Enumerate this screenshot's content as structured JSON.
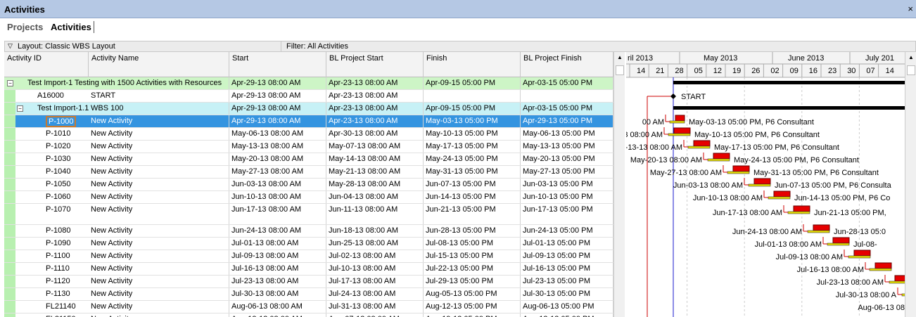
{
  "window": {
    "title": "Activities",
    "close": "×"
  },
  "tabs": [
    {
      "label": "Projects"
    },
    {
      "label": "Activities"
    }
  ],
  "layout_bar": {
    "layout": "Layout: Classic WBS Layout",
    "filter": "Filter: All Activities"
  },
  "columns": [
    "Activity ID",
    "Activity Name",
    "Start",
    "BL Project Start",
    "Finish",
    "BL Project Finish"
  ],
  "rows": [
    {
      "kind": "wbs1",
      "toggle": "−",
      "id": "Test Import-1",
      "name": "Testing with 1500 Activities with Resources",
      "start": "Apr-29-13 08:00 AM",
      "bl_start": "Apr-23-13 08:00 AM",
      "finish": "Apr-09-15 05:00 PM",
      "bl_finish": "Apr-03-15 05:00 PM"
    },
    {
      "kind": "act",
      "id": "A16000",
      "name": "START",
      "start": "Apr-29-13 08:00 AM",
      "bl_start": "Apr-23-13 08:00 AM",
      "finish": "",
      "bl_finish": ""
    },
    {
      "kind": "wbs2",
      "toggle": "−",
      "id": "Test Import-1.1",
      "name": "WBS 100",
      "start": "Apr-29-13 08:00 AM",
      "bl_start": "Apr-23-13 08:00 AM",
      "finish": "Apr-09-15 05:00 PM",
      "bl_finish": "Apr-03-15 05:00 PM"
    },
    {
      "kind": "sel",
      "id": "P-1000",
      "name": "New Activity",
      "start": "Apr-29-13 08:00 AM",
      "bl_start": "Apr-23-13 08:00 AM",
      "finish": "May-03-13 05:00 PM",
      "bl_finish": "Apr-29-13 05:00 PM"
    },
    {
      "kind": "act",
      "id": "P-1010",
      "name": "New Activity",
      "start": "May-06-13 08:00 AM",
      "bl_start": "Apr-30-13 08:00 AM",
      "finish": "May-10-13 05:00 PM",
      "bl_finish": "May-06-13 05:00 PM"
    },
    {
      "kind": "act",
      "id": "P-1020",
      "name": "New Activity",
      "start": "May-13-13 08:00 AM",
      "bl_start": "May-07-13 08:00 AM",
      "finish": "May-17-13 05:00 PM",
      "bl_finish": "May-13-13 05:00 PM"
    },
    {
      "kind": "act",
      "id": "P-1030",
      "name": "New Activity",
      "start": "May-20-13 08:00 AM",
      "bl_start": "May-14-13 08:00 AM",
      "finish": "May-24-13 05:00 PM",
      "bl_finish": "May-20-13 05:00 PM"
    },
    {
      "kind": "act",
      "id": "P-1040",
      "name": "New Activity",
      "start": "May-27-13 08:00 AM",
      "bl_start": "May-21-13 08:00 AM",
      "finish": "May-31-13 05:00 PM",
      "bl_finish": "May-27-13 05:00 PM"
    },
    {
      "kind": "act",
      "id": "P-1050",
      "name": "New Activity",
      "start": "Jun-03-13 08:00 AM",
      "bl_start": "May-28-13 08:00 AM",
      "finish": "Jun-07-13 05:00 PM",
      "bl_finish": "Jun-03-13 05:00 PM"
    },
    {
      "kind": "act",
      "id": "P-1060",
      "name": "New Activity",
      "start": "Jun-10-13 08:00 AM",
      "bl_start": "Jun-04-13 08:00 AM",
      "finish": "Jun-14-13 05:00 PM",
      "bl_finish": "Jun-10-13 05:00 PM"
    },
    {
      "kind": "tall",
      "id": "P-1070",
      "name": "New Activity",
      "start": "Jun-17-13 08:00 AM",
      "bl_start": "Jun-11-13 08:00 AM",
      "finish": "Jun-21-13 05:00 PM",
      "bl_finish": "Jun-17-13 05:00 PM"
    },
    {
      "kind": "act",
      "id": "P-1080",
      "name": "New Activity",
      "start": "Jun-24-13 08:00 AM",
      "bl_start": "Jun-18-13 08:00 AM",
      "finish": "Jun-28-13 05:00 PM",
      "bl_finish": "Jun-24-13 05:00 PM"
    },
    {
      "kind": "act",
      "id": "P-1090",
      "name": "New Activity",
      "start": "Jul-01-13 08:00 AM",
      "bl_start": "Jun-25-13 08:00 AM",
      "finish": "Jul-08-13 05:00 PM",
      "bl_finish": "Jul-01-13 05:00 PM"
    },
    {
      "kind": "act",
      "id": "P-1100",
      "name": "New Activity",
      "start": "Jul-09-13 08:00 AM",
      "bl_start": "Jul-02-13 08:00 AM",
      "finish": "Jul-15-13 05:00 PM",
      "bl_finish": "Jul-09-13 05:00 PM"
    },
    {
      "kind": "act",
      "id": "P-1110",
      "name": "New Activity",
      "start": "Jul-16-13 08:00 AM",
      "bl_start": "Jul-10-13 08:00 AM",
      "finish": "Jul-22-13 05:00 PM",
      "bl_finish": "Jul-16-13 05:00 PM"
    },
    {
      "kind": "act",
      "id": "P-1120",
      "name": "New Activity",
      "start": "Jul-23-13 08:00 AM",
      "bl_start": "Jul-17-13 08:00 AM",
      "finish": "Jul-29-13 05:00 PM",
      "bl_finish": "Jul-23-13 05:00 PM"
    },
    {
      "kind": "act",
      "id": "P-1130",
      "name": "New Activity",
      "start": "Jul-30-13 08:00 AM",
      "bl_start": "Jul-24-13 08:00 AM",
      "finish": "Aug-05-13 05:00 PM",
      "bl_finish": "Jul-30-13 05:00 PM"
    },
    {
      "kind": "act",
      "id": "FL21140",
      "name": "New Activity",
      "start": "Aug-06-13 08:00 AM",
      "bl_start": "Jul-31-13 08:00 AM",
      "finish": "Aug-12-13 05:00 PM",
      "bl_finish": "Aug-06-13 05:00 PM"
    },
    {
      "kind": "act",
      "id": "FL21150",
      "name": "New Activity",
      "start": "Aug-13-13 08:00 AM",
      "bl_start": "Aug-07-13 08:00 AM",
      "finish": "Aug-19-13 05:00 PM",
      "bl_finish": "Aug-13-13 05:00 PM"
    }
  ],
  "gantt": {
    "months": [
      "ril 2013",
      "May 2013",
      "June 2013",
      "July 201"
    ],
    "weeks": [
      "14",
      "21",
      "28",
      "05",
      "12",
      "19",
      "26",
      "02",
      "09",
      "16",
      "23",
      "30",
      "07",
      "14"
    ],
    "milestone_label": "START",
    "bars": [
      {
        "left": "00 AM",
        "right": "May-03-13 05:00 PM, P6 Consultant"
      },
      {
        "left": "3 08:00 AM",
        "right": "May-10-13 05:00 PM, P6 Consultant"
      },
      {
        "left": "y-13-13 08:00 AM",
        "right": "May-17-13 05:00 PM, P6 Consultant"
      },
      {
        "left": "May-20-13 08:00 AM",
        "right": "May-24-13 05:00 PM, P6 Consultant"
      },
      {
        "left": "May-27-13 08:00 AM",
        "right": "May-31-13 05:00 PM, P6 Consultant"
      },
      {
        "left": "Jun-03-13 08:00 AM",
        "right": "Jun-07-13 05:00 PM, P6 Consulta"
      },
      {
        "left": "Jun-10-13 08:00 AM",
        "right": "Jun-14-13 05:00 PM, P6 Co"
      },
      {
        "left": "Jun-17-13 08:00 AM",
        "right": "Jun-21-13 05:00 PM,"
      },
      {
        "left": "Jun-24-13 08:00 AM",
        "right": "Jun-28-13 05:0"
      },
      {
        "left": "Jul-01-13 08:00 AM",
        "right": "Jul-08-"
      },
      {
        "left": "Jul-09-13 08:00 AM",
        "right": ""
      },
      {
        "left": "Jul-16-13 08:00 AM",
        "right": ""
      },
      {
        "left": "Jul-23-13 08:00 AM",
        "right": ""
      },
      {
        "left": "Jul-30-13 08:00 A",
        "right": ""
      },
      {
        "left": "Aug-06-13 08",
        "right": ""
      },
      {
        "left": "Aug-13-",
        "right": ""
      }
    ]
  },
  "colors": {
    "bar": "#e60000",
    "selected": "#3494e0",
    "wbs1": "#cdf5c6",
    "wbs2": "#c7f1f6",
    "data_date": "#1a1acc",
    "link": "#cc0000"
  }
}
